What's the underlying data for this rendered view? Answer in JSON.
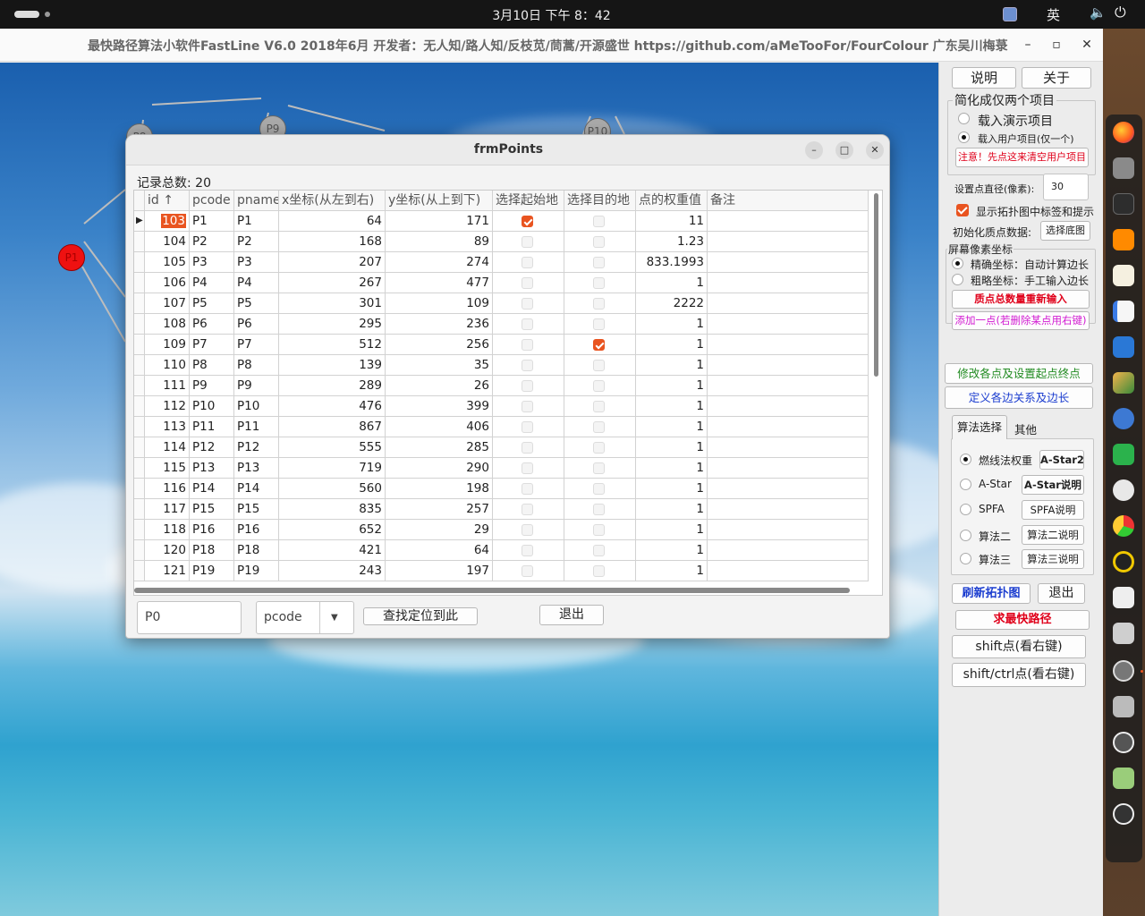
{
  "topbar": {
    "clock": "3月10日 下午 8：42",
    "ime": "英"
  },
  "app": {
    "title": "最快路径算法小软件FastLine V6.0  2018年6月 开发者：无人知/路人知/反枝苋/茼蒿/开源盛世  https://github.com/aMeTooFor/FourColour 广东吴川梅菉",
    "min": "–",
    "max": "▫",
    "close": "✕"
  },
  "canvas": {
    "nodes": [
      "P8",
      "P9",
      "P10",
      "P1",
      "P1"
    ]
  },
  "panel": {
    "help": "说明",
    "about": "关于",
    "simplify_group": "简化成仅两个项目",
    "load_demo": "载入演示项目",
    "load_user": "载入用户项目(仅一个)",
    "clear_warning": "注意！先点这来清空用户项目",
    "diameter_label": "设置点直径(像素):",
    "diameter_value": "30",
    "show_labels": "显示拓扑图中标签和提示",
    "init_label": "初始化质点数据:",
    "choose_bg": "选择底图",
    "pixel_group": "屏幕像素坐标",
    "precise": "精确坐标：自动计算边长",
    "rough": "粗略坐标：手工输入边长",
    "reenter": "质点总数量重新输入",
    "add_point": "添加一点(若删除某点用右键)",
    "modify_points": "修改各点及设置起点终点",
    "define_edges": "定义各边关系及边长",
    "tab_algo": "算法选择",
    "tab_other": "其他",
    "algos": [
      {
        "label": "燃线法权重",
        "btn": "A-Star2"
      },
      {
        "label": "A-Star",
        "btn": "A-Star说明"
      },
      {
        "label": "SPFA",
        "btn": "SPFA说明"
      },
      {
        "label": "算法二",
        "btn": "算法二说明"
      },
      {
        "label": "算法三",
        "btn": "算法三说明"
      }
    ],
    "refresh": "刷新拓扑图",
    "exit": "退出",
    "find_path": "求最快路径",
    "shift_pt": "shift点(看右键)",
    "shift_ctrl_pt": "shift/ctrl点(看右键)"
  },
  "dialog": {
    "title": "frmPoints",
    "count_label": "记录总数:  20",
    "headers": [
      "id ↑",
      "pcode",
      "pname",
      "x坐标(从左到右)",
      "y坐标(从上到下)",
      "选择起始地",
      "选择目的地",
      "点的权重值",
      "备注"
    ],
    "rows": [
      {
        "id": "103",
        "pcode": "P1",
        "pname": "P1",
        "x": "64",
        "y": "171",
        "start": true,
        "dest": false,
        "w": "11"
      },
      {
        "id": "104",
        "pcode": "P2",
        "pname": "P2",
        "x": "168",
        "y": "89",
        "start": false,
        "dest": false,
        "w": "1.23"
      },
      {
        "id": "105",
        "pcode": "P3",
        "pname": "P3",
        "x": "207",
        "y": "274",
        "start": false,
        "dest": false,
        "w": "833.1993"
      },
      {
        "id": "106",
        "pcode": "P4",
        "pname": "P4",
        "x": "267",
        "y": "477",
        "start": false,
        "dest": false,
        "w": "1"
      },
      {
        "id": "107",
        "pcode": "P5",
        "pname": "P5",
        "x": "301",
        "y": "109",
        "start": false,
        "dest": false,
        "w": "2222"
      },
      {
        "id": "108",
        "pcode": "P6",
        "pname": "P6",
        "x": "295",
        "y": "236",
        "start": false,
        "dest": false,
        "w": "1"
      },
      {
        "id": "109",
        "pcode": "P7",
        "pname": "P7",
        "x": "512",
        "y": "256",
        "start": false,
        "dest": true,
        "w": "1"
      },
      {
        "id": "110",
        "pcode": "P8",
        "pname": "P8",
        "x": "139",
        "y": "35",
        "start": false,
        "dest": false,
        "w": "1"
      },
      {
        "id": "111",
        "pcode": "P9",
        "pname": "P9",
        "x": "289",
        "y": "26",
        "start": false,
        "dest": false,
        "w": "1"
      },
      {
        "id": "112",
        "pcode": "P10",
        "pname": "P10",
        "x": "476",
        "y": "399",
        "start": false,
        "dest": false,
        "w": "1"
      },
      {
        "id": "113",
        "pcode": "P11",
        "pname": "P11",
        "x": "867",
        "y": "406",
        "start": false,
        "dest": false,
        "w": "1"
      },
      {
        "id": "114",
        "pcode": "P12",
        "pname": "P12",
        "x": "555",
        "y": "285",
        "start": false,
        "dest": false,
        "w": "1"
      },
      {
        "id": "115",
        "pcode": "P13",
        "pname": "P13",
        "x": "719",
        "y": "290",
        "start": false,
        "dest": false,
        "w": "1"
      },
      {
        "id": "116",
        "pcode": "P14",
        "pname": "P14",
        "x": "560",
        "y": "198",
        "start": false,
        "dest": false,
        "w": "1"
      },
      {
        "id": "117",
        "pcode": "P15",
        "pname": "P15",
        "x": "835",
        "y": "257",
        "start": false,
        "dest": false,
        "w": "1"
      },
      {
        "id": "118",
        "pcode": "P16",
        "pname": "P16",
        "x": "652",
        "y": "29",
        "start": false,
        "dest": false,
        "w": "1"
      },
      {
        "id": "120",
        "pcode": "P18",
        "pname": "P18",
        "x": "421",
        "y": "64",
        "start": false,
        "dest": false,
        "w": "1"
      },
      {
        "id": "121",
        "pcode": "P19",
        "pname": "P19",
        "x": "243",
        "y": "197",
        "start": false,
        "dest": false,
        "w": "1"
      }
    ],
    "search_value": "P0",
    "field_value": "pcode",
    "locate": "查找定位到此",
    "exit": "退出"
  },
  "colors": {
    "accent": "#e95420",
    "warning": "#e0001a",
    "magenta": "#d21ad2",
    "green": "#208a20",
    "blue": "#1a3ccf"
  },
  "dock_icons": [
    "firefox-icon",
    "files-icon",
    "terminal-icon",
    "sublime-icon",
    "text-editor-icon",
    "notes-icon",
    "vscode-icon",
    "paint-icon",
    "settings-icon",
    "wechat-icon",
    "chat-icon",
    "disk-usage-icon",
    "music-icon",
    "camera-icon",
    "database-icon",
    "gear-icon",
    "ssd-icon",
    "settings-active-icon",
    "trash-icon",
    "ubuntu-icon"
  ]
}
